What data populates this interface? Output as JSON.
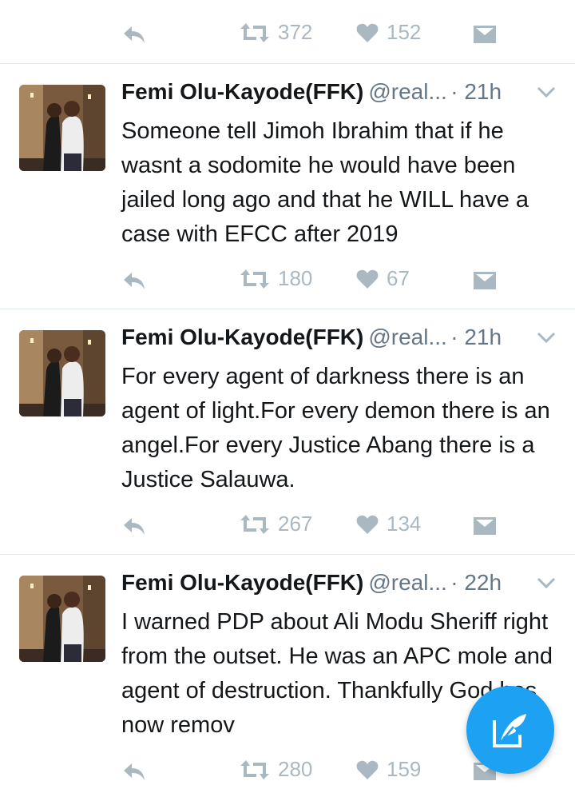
{
  "top": {
    "retweets": "372",
    "likes": "152"
  },
  "tweets": [
    {
      "name": "Femi Olu-Kayode(FFK)",
      "handle": "@real...",
      "time": "· 21h",
      "text": "Someone tell Jimoh Ibrahim that if he wasnt a sodomite he would have been jailed long ago and that he WILL have a case with EFCC after 2019",
      "retweets": "180",
      "likes": "67"
    },
    {
      "name": "Femi Olu-Kayode(FFK)",
      "handle": "@real...",
      "time": "· 21h",
      "text": "For every agent of darkness there is an agent of light.For every demon there is an angel.For every Justice Abang there is a Justice Salauwa.",
      "retweets": "267",
      "likes": "134"
    },
    {
      "name": "Femi Olu-Kayode(FFK)",
      "handle": "@real...",
      "time": "· 22h",
      "text": "I warned PDP about Ali Modu Sheriff right from the outset. He was an APC mole and agent of destruction. Thankfully God has now remov",
      "retweets": "280",
      "likes": "159"
    }
  ],
  "icons": {
    "reply": "reply-icon",
    "retweet": "retweet-icon",
    "like": "heart-icon",
    "dm": "envelope-icon",
    "more": "chevron-down-icon",
    "compose": "compose-icon"
  },
  "colors": {
    "accent": "#1da1f2",
    "icon_gray": "#aab8c2",
    "text": "#14171a",
    "secondary": "#657786",
    "divider": "#e1e8ed"
  }
}
